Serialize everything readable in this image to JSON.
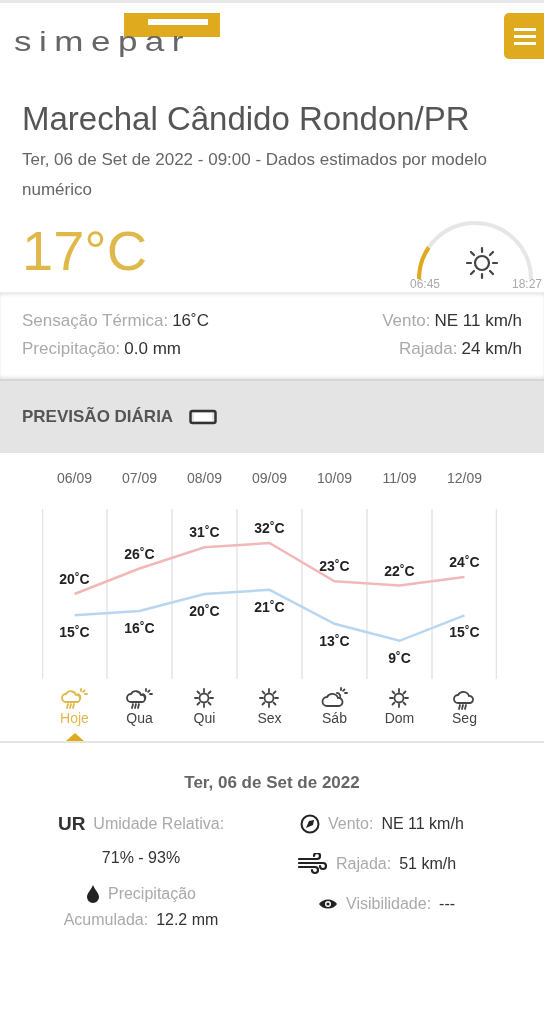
{
  "header": {
    "logo": "simepar"
  },
  "location": {
    "title": "Marechal Cândido Rondon/PR",
    "subtitle": "Ter, 06 de Set de 2022 - 09:00 - Dados estimados por modelo numérico"
  },
  "current": {
    "temperature": "17°C",
    "sunrise": "06:45",
    "sunset": "18:27",
    "stats": [
      {
        "label": "Sensação Térmica:",
        "value": "16˚C"
      },
      {
        "label": "Vento:",
        "value": "NE 11 km/h"
      },
      {
        "label": "Precipitação:",
        "value": "0.0 mm"
      },
      {
        "label": "Rajada:",
        "value": "24 km/h"
      }
    ]
  },
  "forecast": {
    "title": "PREVISÃO DIÁRIA",
    "chart_data": {
      "type": "line",
      "categories": [
        "06/09",
        "07/09",
        "08/09",
        "09/09",
        "10/09",
        "11/09",
        "12/09"
      ],
      "series": [
        {
          "color": "#f2b8b8",
          "values": [
            20,
            26,
            31,
            32,
            23,
            22,
            24
          ],
          "value_labels": [
            "20˚C",
            "26˚C",
            "31˚C",
            "32˚C",
            "23˚C",
            "22˚C",
            "24˚C"
          ]
        },
        {
          "color": "#b8d6f0",
          "values": [
            15,
            16,
            20,
            21,
            13,
            9,
            15
          ],
          "value_labels": [
            "15˚C",
            "16˚C",
            "20˚C",
            "21˚C",
            "13˚C",
            "9˚C",
            "15˚C"
          ]
        }
      ]
    },
    "days": [
      {
        "label": "Hoje",
        "kind": "rain-sun",
        "selected": true
      },
      {
        "label": "Qua",
        "kind": "rain-sun",
        "selected": false
      },
      {
        "label": "Qui",
        "kind": "sun",
        "selected": false
      },
      {
        "label": "Sex",
        "kind": "sun",
        "selected": false
      },
      {
        "label": "Sáb",
        "kind": "cloud-sun",
        "selected": false
      },
      {
        "label": "Dom",
        "kind": "sun",
        "selected": false
      },
      {
        "label": "Seg",
        "kind": "rain",
        "selected": false
      }
    ]
  },
  "details": {
    "date": "Ter, 06 de Set de 2022",
    "items": [
      {
        "kind": "humidity",
        "badge": "UR",
        "label": "Umidade Relativa:",
        "value": "71% - 93%"
      },
      {
        "kind": "precipitation",
        "label": "Precipitação",
        "sublabel": "Acumulada:",
        "value": "12.2 mm"
      },
      {
        "kind": "wind",
        "label": "Vento:",
        "value": "NE 11 km/h"
      },
      {
        "kind": "gust",
        "label": "Rajada:",
        "value": "51 km/h"
      },
      {
        "kind": "visibility",
        "label": "Visibilidade:",
        "value": "---"
      }
    ]
  }
}
